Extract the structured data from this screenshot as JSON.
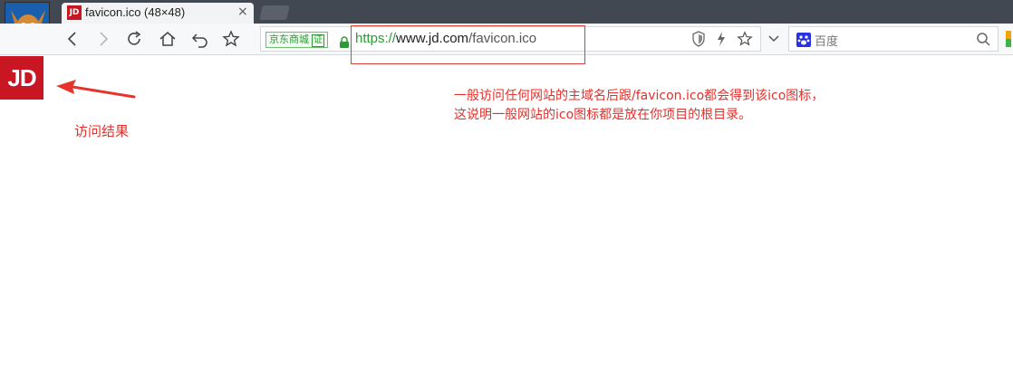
{
  "tab": {
    "favicon_text": "JD",
    "title": "favicon.ico (48×48)",
    "close_glyph": "×"
  },
  "toolbar": {
    "icons": [
      "back-icon",
      "forward-icon",
      "reload-icon",
      "home-icon",
      "undo-icon",
      "bookmark-star-icon"
    ]
  },
  "address_bar": {
    "site_name": "京东商城",
    "verified_label": "证",
    "url_scheme": "https://",
    "url_host": "www.jd.com",
    "url_path": "/favicon.ico"
  },
  "search": {
    "placeholder": "百度"
  },
  "content": {
    "favicon_text": "JD",
    "result_label": "访问结果",
    "annotation_line1": "一般访问任何网站的主域名后跟/favicon.ico都会得到该ico图标，",
    "annotation_line2": "这说明一般网站的ico图标都是放在你项目的根目录。"
  },
  "colors": {
    "brand_red": "#c81623",
    "annotation_red": "#e0322e",
    "secure_green": "#2d9a36"
  }
}
